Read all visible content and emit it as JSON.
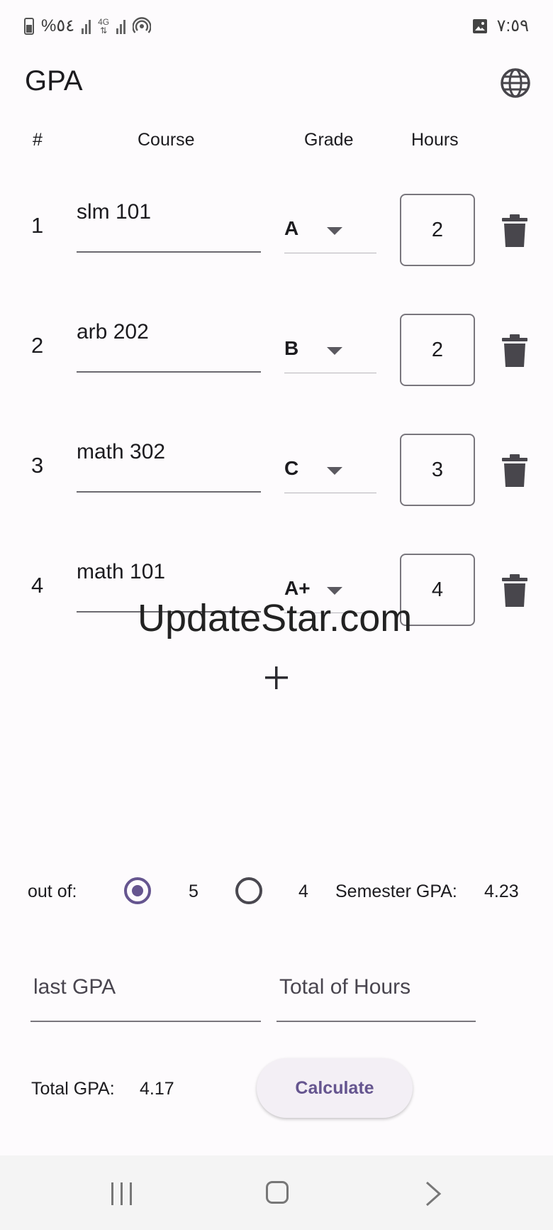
{
  "status_bar": {
    "battery_text": "%٥٤",
    "network": "4G",
    "time": "٧:٥٩"
  },
  "app_bar": {
    "title": "GPA",
    "language_icon": "globe-icon"
  },
  "table_header": {
    "num": "#",
    "course": "Course",
    "grade": "Grade",
    "hours": "Hours"
  },
  "courses": [
    {
      "num": "1",
      "name": "slm 101",
      "grade": "A",
      "hours": "2"
    },
    {
      "num": "2",
      "name": "arb 202",
      "grade": "B",
      "hours": "2"
    },
    {
      "num": "3",
      "name": "math 302",
      "grade": "C",
      "hours": "3"
    },
    {
      "num": "4",
      "name": "math 101",
      "grade": "A+",
      "hours": "4"
    }
  ],
  "watermark": "UpdateStar.com",
  "scale": {
    "label": "out of:",
    "options": [
      {
        "label": "5",
        "selected": true
      },
      {
        "label": "4",
        "selected": false
      }
    ],
    "semester_label": "Semester GPA:",
    "semester_value": "4.23"
  },
  "inputs": {
    "last_gpa_placeholder": "last GPA",
    "total_hours_placeholder": "Total of Hours"
  },
  "result": {
    "total_label": "Total GPA:",
    "total_value": "4.17",
    "calculate_label": "Calculate"
  },
  "colors": {
    "accent": "#65558f",
    "background": "#fdfbfd",
    "icon_dark": "#48464c"
  }
}
